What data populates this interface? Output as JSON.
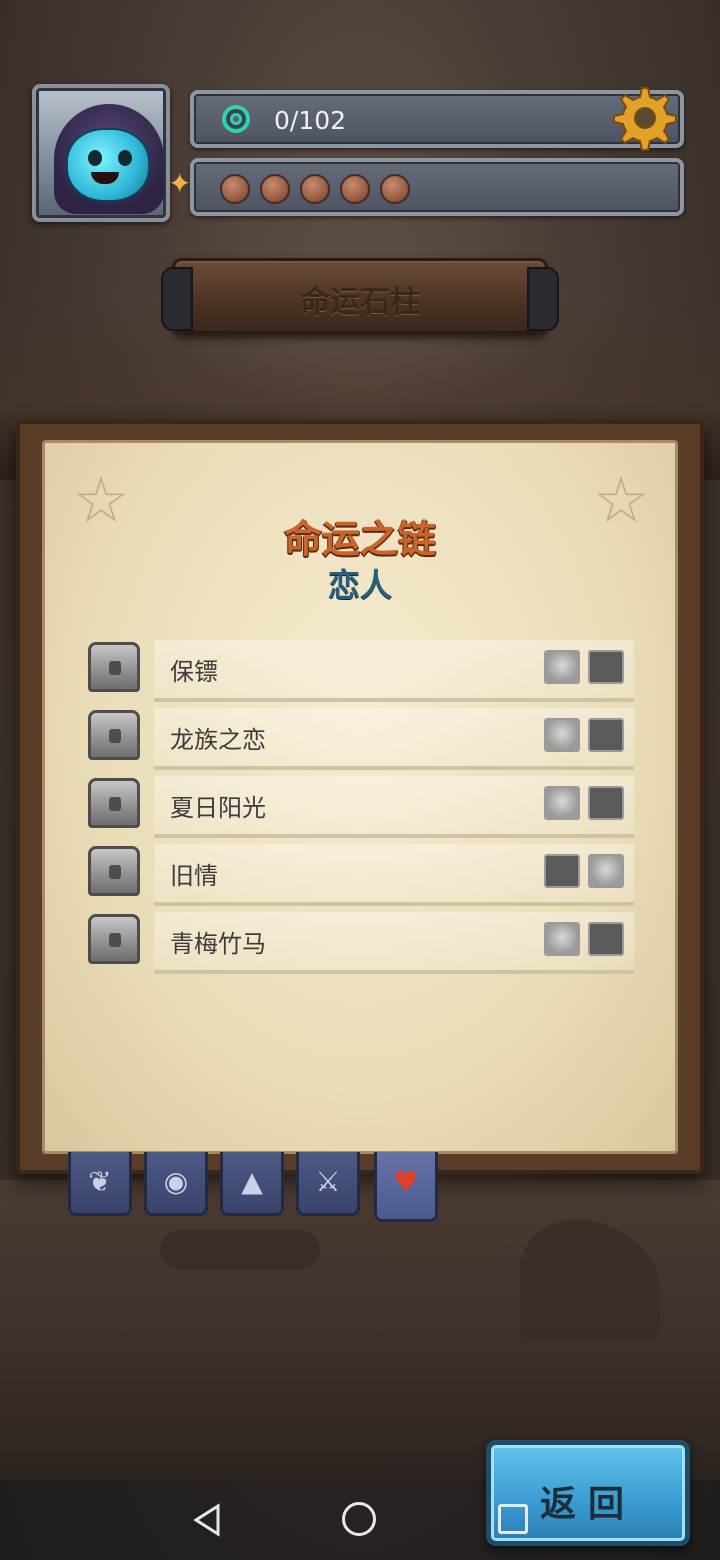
{
  "hud": {
    "counter": "0/102",
    "tokens": 5
  },
  "header": {
    "title": "命运石柱"
  },
  "panel": {
    "title": "命运之链",
    "subtitle": "恋人",
    "rows": [
      {
        "label": "保镖"
      },
      {
        "label": "龙族之恋"
      },
      {
        "label": "夏日阳光"
      },
      {
        "label": "旧情"
      },
      {
        "label": "青梅竹马"
      }
    ]
  },
  "tabs": [
    "scroll-icon",
    "bag-icon",
    "graduation-cap-icon",
    "crossed-swords-icon",
    "heart-arrow-icon"
  ],
  "return_button": {
    "label": "返回"
  },
  "colors": {
    "title": "#c9642a",
    "subtitle": "#2a5f7a",
    "return": "#3a9bd2"
  }
}
